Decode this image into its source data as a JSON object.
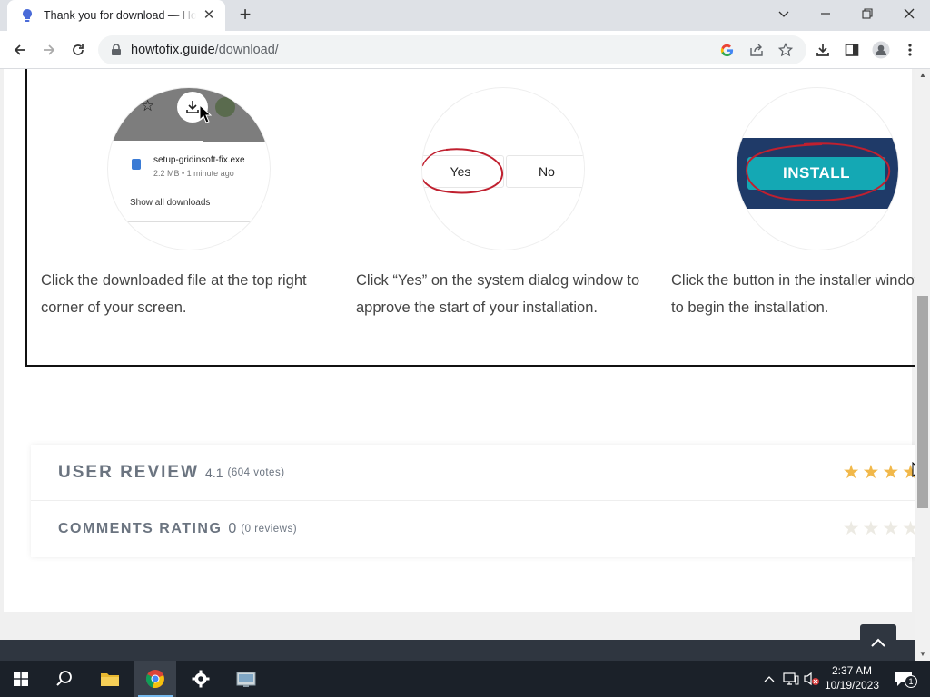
{
  "browser": {
    "tab_title": "Thank you for download — HowToFix.Guide",
    "url_host": "howtofix.guide",
    "url_path": "/download/"
  },
  "steps": [
    {
      "illustration": {
        "file_name": "setup-gridinsoft-fix.exe",
        "file_meta": "2.2 MB • 1 minute ago",
        "show_all": "Show all downloads"
      },
      "text": "Click the downloaded file at the top right corner of your screen."
    },
    {
      "illustration": {
        "yes_label": "Yes",
        "no_label": "No"
      },
      "text": "Click “Yes” on the system dialog window to approve the start of your installation."
    },
    {
      "illustration": {
        "button_label": "INSTALL"
      },
      "text": "Click the button in the installer window to begin the installation."
    }
  ],
  "reviews": {
    "user_review": {
      "label": "USER REVIEW",
      "score": "4.1",
      "votes": "(604 votes)",
      "stars": 4.1
    },
    "comments_rating": {
      "label": "COMMENTS RATING",
      "score": "0",
      "votes": "(0 reviews)",
      "stars": 0
    }
  },
  "taskbar": {
    "time": "2:37 AM",
    "date": "10/19/2023",
    "notification_count": "1"
  },
  "colors": {
    "star_gold": "#f1b84a",
    "install_bg": "#1f3a68",
    "install_button": "#14a8b4",
    "annotation_red": "#c0202f"
  },
  "icons": [
    "bulb-favicon",
    "close-icon",
    "plus-icon",
    "chevron-down-icon",
    "minimize-icon",
    "restore-icon",
    "back-icon",
    "forward-icon",
    "reload-icon",
    "lock-icon",
    "google-icon",
    "share-icon",
    "star-icon",
    "download-icon",
    "sidepanel-icon",
    "profile-icon",
    "more-icon",
    "chevron-up-icon",
    "windows-icon",
    "search-icon",
    "folder-icon",
    "chrome-icon",
    "gear-icon",
    "app-icon",
    "network-icon",
    "volume-muted-icon",
    "notification-icon"
  ]
}
